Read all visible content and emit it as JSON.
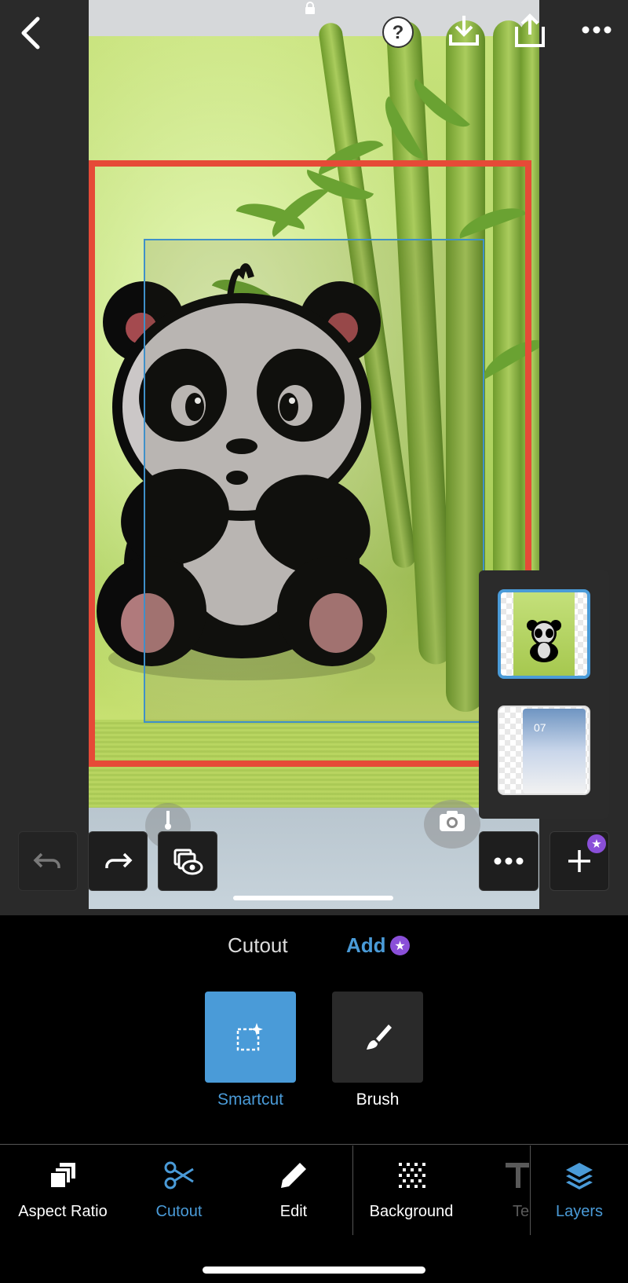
{
  "app": {
    "accent": "#4a9bd8",
    "premium_badge_color": "#8a4fd8",
    "selection_color": "#e64a37"
  },
  "header": {
    "back_icon": "chevron-left-icon",
    "help_icon": "help-icon",
    "download_icon": "download-icon",
    "share_icon": "share-icon",
    "more_icon": "more-horizontal-icon"
  },
  "layers_panel": {
    "layers": [
      {
        "name": "panda-layer",
        "selected": true
      },
      {
        "name": "phone-screenshot-layer",
        "selected": false
      },
      {
        "thumb_text": "07"
      }
    ]
  },
  "toolbar": {
    "undo_icon": "undo-icon",
    "redo_icon": "redo-icon",
    "preview_icon": "layer-preview-icon",
    "more_icon": "more-horizontal-icon",
    "add_icon": "plus-icon"
  },
  "cutout_tabs": {
    "tab1": "Cutout",
    "tab2": "Add"
  },
  "tools": [
    {
      "label": "Smartcut",
      "icon": "smartcut-icon",
      "active": true
    },
    {
      "label": "Brush",
      "icon": "brush-icon",
      "active": false
    }
  ],
  "bottom_nav": [
    {
      "label": "Aspect Ratio",
      "icon": "aspect-ratio-icon",
      "active": false
    },
    {
      "label": "Cutout",
      "icon": "scissors-icon",
      "active": true
    },
    {
      "label": "Edit",
      "icon": "pencil-icon",
      "active": false
    },
    {
      "label": "Background",
      "icon": "background-icon",
      "active": false
    },
    {
      "label": "Te",
      "icon": "text-icon",
      "active": false
    },
    {
      "label": "Layers",
      "icon": "layers-icon",
      "active": true
    }
  ]
}
